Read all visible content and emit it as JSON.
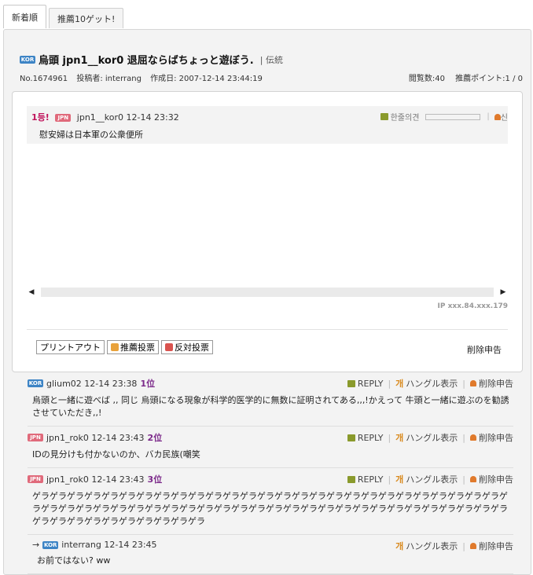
{
  "tabs": [
    {
      "label": "新着順"
    },
    {
      "label": "推薦10ゲット!"
    }
  ],
  "post": {
    "flag": "KOR",
    "title": "烏頭 jpn1__kor0 退屈ならばちょっと遊ぼう.",
    "category": "| 伝統",
    "number": "No.1674961",
    "author": "投稿者: interrang",
    "date": "作成日: 2007-12-14 23:44:19",
    "views": "閲覧数:40",
    "points": "推薦ポイント:1 / 0"
  },
  "embed": {
    "rank": "1등!",
    "flag": "JPN",
    "user": "jpn1__kor0 12-14 23:32",
    "text": "慰安婦は日本軍の公衆便所",
    "tool_label": "한줄의견",
    "tool_tail": "신"
  },
  "ip": "IP xxx.84.xxx.179",
  "buttons": {
    "print": "プリントアウト",
    "recommend": "推薦投票",
    "oppose": "反対投票",
    "report": "削除申告"
  },
  "comment_tools": {
    "reply": "REPLY",
    "hangul": "ハングル表示",
    "report": "削除申告",
    "hangul_icon": "개"
  },
  "comments": [
    {
      "flag": "KOR",
      "user": "glium02 12-14 23:38",
      "rank": "1位",
      "text": "烏頭と一緒に遊べば ,, 同じ 烏頭になる現象が科学的医学的に無数に証明されてある,,,!かえって 牛頭と一緒に遊ぶのを勧誘させていただき,,!"
    },
    {
      "flag": "JPN",
      "user": "jpn1_rok0 12-14 23:43",
      "rank": "2位",
      "text": "IDの見分けも付かないのか、バカ民族(嘲笑"
    },
    {
      "flag": "JPN",
      "user": "jpn1_rok0 12-14 23:43",
      "rank": "3位",
      "text": "ゲラゲラゲラゲラゲラゲラゲラゲラゲラゲラゲラゲラゲラゲラゲラゲラゲラゲラゲラゲラゲラゲラゲラゲラゲラゲラゲラゲラゲラゲラゲラゲラゲラゲラゲラゲラゲラゲラゲラゲラゲラゲラゲラゲラゲラゲラゲラゲラゲラゲラゲラゲラゲラゲラゲラゲラゲラゲラゲラゲラゲラゲラゲラゲラゲラ"
    },
    {
      "arrow": "→",
      "flag": "KOR",
      "user": "interrang 12-14 23:45",
      "text": "お前ではない? ww"
    }
  ]
}
